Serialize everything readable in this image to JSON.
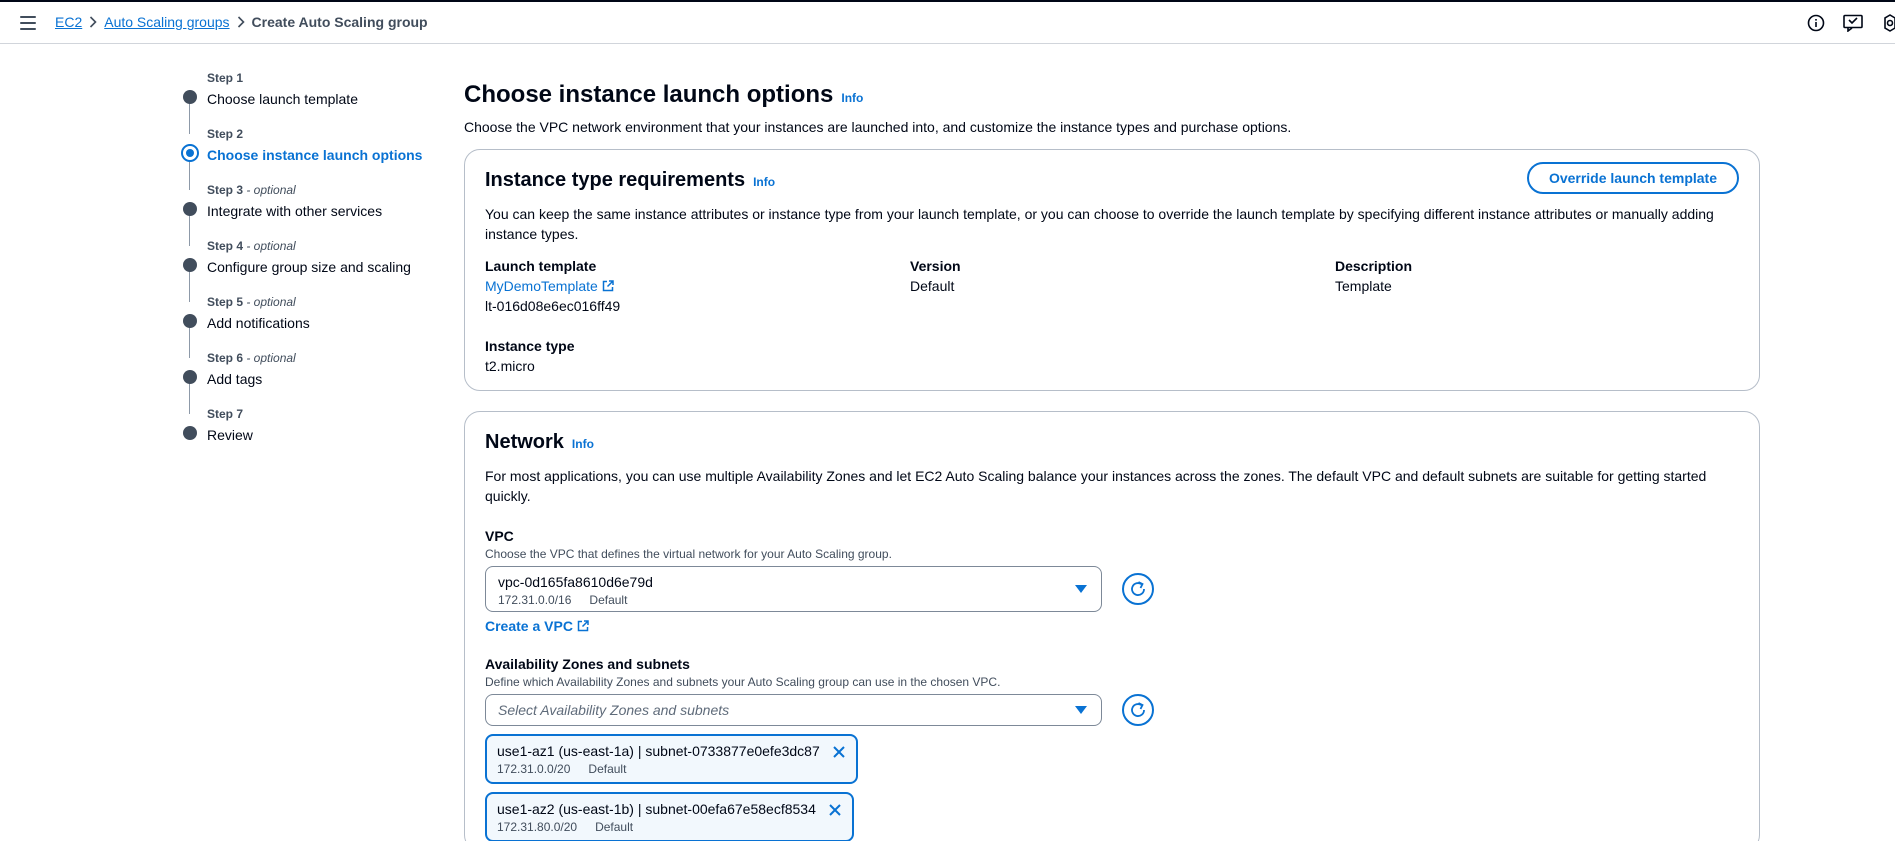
{
  "breadcrumb": {
    "ec2": "EC2",
    "asg": "Auto Scaling groups",
    "current": "Create Auto Scaling group"
  },
  "steps": [
    {
      "num": "Step 1",
      "optional": "",
      "title": "Choose launch template"
    },
    {
      "num": "Step 2",
      "optional": "",
      "title": "Choose instance launch options"
    },
    {
      "num": "Step 3",
      "optional": " - optional",
      "title": "Integrate with other services"
    },
    {
      "num": "Step 4",
      "optional": " - optional",
      "title": "Configure group size and scaling"
    },
    {
      "num": "Step 5",
      "optional": " - optional",
      "title": "Add notifications"
    },
    {
      "num": "Step 6",
      "optional": " - optional",
      "title": "Add tags"
    },
    {
      "num": "Step 7",
      "optional": "",
      "title": "Review"
    }
  ],
  "active_step": 2,
  "page": {
    "title": "Choose instance launch options",
    "info": "Info",
    "description": "Choose the VPC network environment that your instances are launched into, and customize the instance types and purchase options."
  },
  "instance_req": {
    "title": "Instance type requirements",
    "info": "Info",
    "override_btn": "Override launch template",
    "description": "You can keep the same instance attributes or instance type from your launch template, or you can choose to override the launch template by specifying different instance attributes or manually adding instance types.",
    "launch_template_label": "Launch template",
    "launch_template_name": "MyDemoTemplate",
    "launch_template_id": "lt-016d08e6ec016ff49",
    "version_label": "Version",
    "version_value": "Default",
    "description_label": "Description",
    "description_value": "Template",
    "instance_type_label": "Instance type",
    "instance_type_value": "t2.micro"
  },
  "network": {
    "title": "Network",
    "info": "Info",
    "description": "For most applications, you can use multiple Availability Zones and let EC2 Auto Scaling balance your instances across the zones. The default VPC and default subnets are suitable for getting started quickly.",
    "vpc_label": "VPC",
    "vpc_desc": "Choose the VPC that defines the virtual network for your Auto Scaling group.",
    "vpc_value": "vpc-0d165fa8610d6e79d",
    "vpc_cidr": "172.31.0.0/16",
    "vpc_tag": "Default",
    "create_vpc": "Create a VPC",
    "az_label": "Availability Zones and subnets",
    "az_desc": "Define which Availability Zones and subnets your Auto Scaling group can use in the chosen VPC.",
    "az_placeholder": "Select Availability Zones and subnets",
    "subnets": [
      {
        "name": "use1-az1 (us-east-1a) | subnet-0733877e0efe3dc87",
        "cidr": "172.31.0.0/20",
        "tag": "Default"
      },
      {
        "name": "use1-az2 (us-east-1b) | subnet-00efa67e58ecf8534",
        "cidr": "172.31.80.0/20",
        "tag": "Default"
      }
    ]
  },
  "colors": {
    "accent": "#0972d3",
    "text": "#000716",
    "muted": "#414d5c",
    "border": "#b6bec9"
  }
}
